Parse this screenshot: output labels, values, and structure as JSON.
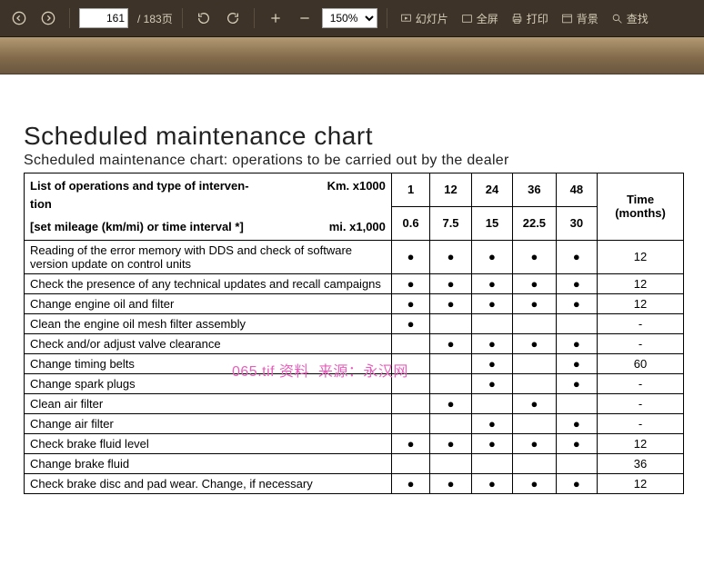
{
  "toolbar": {
    "page_current": "161",
    "page_total": "/ 183页",
    "zoom": "150%",
    "slideshow": "幻灯片",
    "fullscreen": "全屏",
    "print": "打印",
    "background": "背景",
    "find": "查找"
  },
  "page": {
    "title": "Scheduled maintenance chart",
    "subtitle": "Scheduled maintenance chart: operations to be carried out by the dealer",
    "header_ops_line1": "List of operations and type of interven-",
    "header_ops_line2": "tion",
    "header_ops_line3": "[set mileage (km/mi) or time interval *]",
    "km_label": "Km. x1000",
    "mi_label": "mi. x1,000",
    "time_label": "Time (months)",
    "km_values": [
      "1",
      "12",
      "24",
      "36",
      "48"
    ],
    "mi_values": [
      "0.6",
      "7.5",
      "15",
      "22.5",
      "30"
    ]
  },
  "rows": [
    {
      "op": "Reading of the error memory with DDS and check of software version update on control units",
      "marks": [
        true,
        true,
        true,
        true,
        true
      ],
      "time": "12"
    },
    {
      "op": "Check the presence of any technical updates and recall campaigns",
      "marks": [
        true,
        true,
        true,
        true,
        true
      ],
      "time": "12"
    },
    {
      "op": "Change engine oil and filter",
      "marks": [
        true,
        true,
        true,
        true,
        true
      ],
      "time": "12"
    },
    {
      "op": "Clean the engine oil mesh filter assembly",
      "marks": [
        true,
        false,
        false,
        false,
        false
      ],
      "time": "-"
    },
    {
      "op": "Check and/or adjust valve clearance",
      "marks": [
        false,
        true,
        true,
        true,
        true
      ],
      "time": "-"
    },
    {
      "op": "Change timing belts",
      "marks": [
        false,
        false,
        true,
        false,
        true
      ],
      "time": "60"
    },
    {
      "op": "Change spark plugs",
      "marks": [
        false,
        false,
        true,
        false,
        true
      ],
      "time": "-"
    },
    {
      "op": "Clean air filter",
      "marks": [
        false,
        true,
        false,
        true,
        false
      ],
      "time": "-"
    },
    {
      "op": "Change air filter",
      "marks": [
        false,
        false,
        true,
        false,
        true
      ],
      "time": "-"
    },
    {
      "op": "Check brake fluid level",
      "marks": [
        true,
        true,
        true,
        true,
        true
      ],
      "time": "12"
    },
    {
      "op": "Change brake fluid",
      "marks": [
        false,
        false,
        false,
        false,
        false
      ],
      "time": "36"
    },
    {
      "op": "Check brake disc and pad wear. Change, if necessary",
      "marks": [
        true,
        true,
        true,
        true,
        true
      ],
      "time": "12"
    }
  ],
  "watermark": "065.tif 资料&nbsp;&nbsp;来源：永汉网",
  "chart_data": {
    "type": "table",
    "title": "Scheduled maintenance chart",
    "columns_km_x1000": [
      1,
      12,
      24,
      36,
      48
    ],
    "columns_mi_x1000": [
      0.6,
      7.5,
      15,
      22.5,
      30
    ],
    "time_months_column": true,
    "rows": [
      {
        "operation": "Reading of the error memory with DDS and check of software version update on control units",
        "at": [
          1,
          12,
          24,
          36,
          48
        ],
        "time_months": 12
      },
      {
        "operation": "Check the presence of any technical updates and recall campaigns",
        "at": [
          1,
          12,
          24,
          36,
          48
        ],
        "time_months": 12
      },
      {
        "operation": "Change engine oil and filter",
        "at": [
          1,
          12,
          24,
          36,
          48
        ],
        "time_months": 12
      },
      {
        "operation": "Clean the engine oil mesh filter assembly",
        "at": [
          1
        ],
        "time_months": null
      },
      {
        "operation": "Check and/or adjust valve clearance",
        "at": [
          12,
          24,
          36,
          48
        ],
        "time_months": null
      },
      {
        "operation": "Change timing belts",
        "at": [
          24,
          48
        ],
        "time_months": 60
      },
      {
        "operation": "Change spark plugs",
        "at": [
          24,
          48
        ],
        "time_months": null
      },
      {
        "operation": "Clean air filter",
        "at": [
          12,
          36
        ],
        "time_months": null
      },
      {
        "operation": "Change air filter",
        "at": [
          24,
          48
        ],
        "time_months": null
      },
      {
        "operation": "Check brake fluid level",
        "at": [
          1,
          12,
          24,
          36,
          48
        ],
        "time_months": 12
      },
      {
        "operation": "Change brake fluid",
        "at": [],
        "time_months": 36
      },
      {
        "operation": "Check brake disc and pad wear. Change, if necessary",
        "at": [
          1,
          12,
          24,
          36,
          48
        ],
        "time_months": 12
      }
    ]
  }
}
